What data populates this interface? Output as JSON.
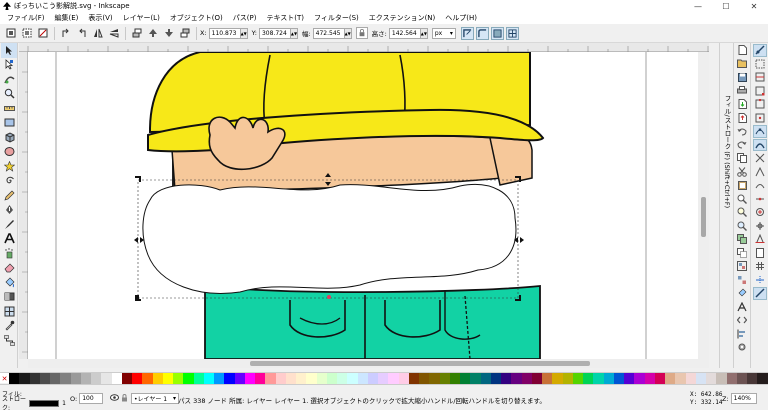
{
  "window": {
    "title": "ぽっちいこう影解説.svg - Inkscape",
    "controls": [
      "minimize-icon",
      "maximize-icon",
      "close-icon"
    ]
  },
  "menu": [
    "ファイル(F)",
    "編集(E)",
    "表示(V)",
    "レイヤー(L)",
    "オブジェクト(O)",
    "パス(P)",
    "テキスト(T)",
    "フィルター(S)",
    "エクステンション(N)",
    "ヘルプ(H)"
  ],
  "toolbar": {
    "x_label": "X:",
    "x_value": "110.873",
    "y_label": "Y:",
    "y_value": "308.724",
    "w_label": "幅:",
    "w_value": "472.545",
    "h_label": "高さ:",
    "h_value": "142.564",
    "unit": "px"
  },
  "dialog": {
    "tab_label": "フィル/ストローク (F) (Shift+Ctrl+F)"
  },
  "palette": {
    "colors": [
      "#000000",
      "#1a1a1a",
      "#333333",
      "#4d4d4d",
      "#666666",
      "#808080",
      "#999999",
      "#b3b3b3",
      "#cccccc",
      "#e6e6e6",
      "#ffffff",
      "#800000",
      "#ff0000",
      "#ff6600",
      "#ffcc00",
      "#ffff00",
      "#99ff00",
      "#00ff00",
      "#00ff99",
      "#00ffff",
      "#0099ff",
      "#0000ff",
      "#6600ff",
      "#ff00ff",
      "#ff0099",
      "#ff9999",
      "#ffcccc",
      "#ffe0cc",
      "#fff0cc",
      "#ffffcc",
      "#e6ffcc",
      "#ccffcc",
      "#ccffe6",
      "#ccffff",
      "#cce6ff",
      "#ccccff",
      "#e6ccff",
      "#ffccff",
      "#ffcce6",
      "#803300",
      "#805500",
      "#806600",
      "#668000",
      "#338000",
      "#008033",
      "#008066",
      "#006680",
      "#003380",
      "#330080",
      "#660080",
      "#800066",
      "#800033",
      "#c87137",
      "#d4aa00",
      "#b3b300",
      "#55d400",
      "#00d455",
      "#00d4aa",
      "#00aad4",
      "#0055d4",
      "#5500d4",
      "#aa00d4",
      "#d400aa",
      "#d40055",
      "#deaa87",
      "#e9c6af",
      "#f4d7d7",
      "#d7e3f4",
      "#e3dbdb",
      "#c8beb7",
      "#916f6f",
      "#6c5353",
      "#483737",
      "#241c1c"
    ]
  },
  "status": {
    "fill_label": "フィル:",
    "stroke_label": "ストローク:",
    "stroke_width": "1",
    "opacity_label": "O:",
    "opacity_value": "100",
    "layer_value": "•レイヤー 1",
    "message": "パス 338 ノード 所属: レイヤー レイヤー 1. 選択オブジェクトのクリックで拡大縮小ハンドル/回転ハンドルを切り替えます。",
    "x_coord": "X:  642.86",
    "y_coord": "Y:  332.14",
    "zoom_label": "Z:",
    "zoom_value": "140%"
  },
  "colors": {
    "helmet": "#f7e818",
    "skin": "#f7c99b",
    "shirt": "#12d2a4",
    "outline": "#111111"
  }
}
